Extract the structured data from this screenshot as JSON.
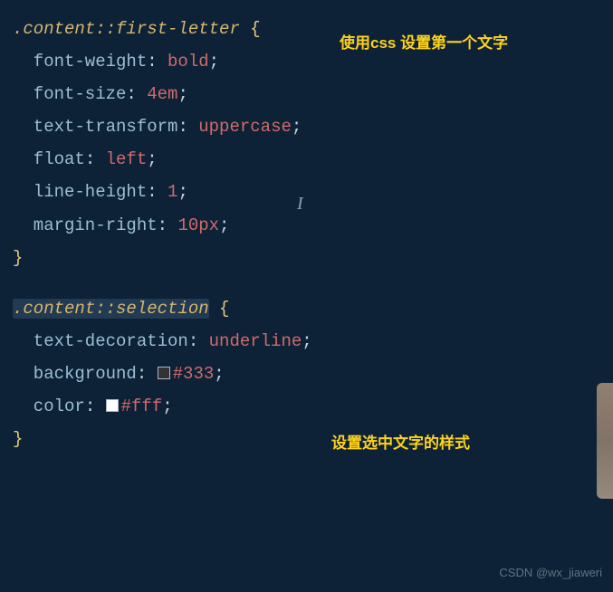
{
  "notes": {
    "first_letter": "使用css 设置第一个文字",
    "selection": "设置选中文字的样式"
  },
  "watermark": "CSDN @wx_jiaweri",
  "colors": {
    "swatch333": "#333333",
    "swatchFFF": "#ffffff"
  },
  "block1": {
    "selector": ".content::first-letter",
    "open": "{",
    "close": "}",
    "lines": [
      {
        "prop": "font-weight",
        "sep": ": ",
        "val": "bold",
        "end": ";"
      },
      {
        "prop": "font-size",
        "sep": ": ",
        "val": "4em",
        "end": ";"
      },
      {
        "prop": "text-transform",
        "sep": ": ",
        "val": "uppercase",
        "end": ";"
      },
      {
        "prop": "float",
        "sep": ": ",
        "val": "left",
        "end": ";"
      },
      {
        "prop": "line-height",
        "sep": ": ",
        "val": "1",
        "end": ";"
      },
      {
        "prop": "margin-right",
        "sep": ": ",
        "val": "10px",
        "end": ";"
      }
    ]
  },
  "block2": {
    "selector": ".content::selection",
    "open": "{",
    "close": "}",
    "lines": [
      {
        "prop": "text-decoration",
        "sep": ": ",
        "val": "underline",
        "end": ";"
      },
      {
        "prop": "background",
        "sep": ": ",
        "val": "#333",
        "end": ";",
        "swatch": "swatch333"
      },
      {
        "prop": "color",
        "sep": ": ",
        "val": "#fff",
        "end": ";",
        "swatch": "swatchFFF"
      }
    ]
  }
}
